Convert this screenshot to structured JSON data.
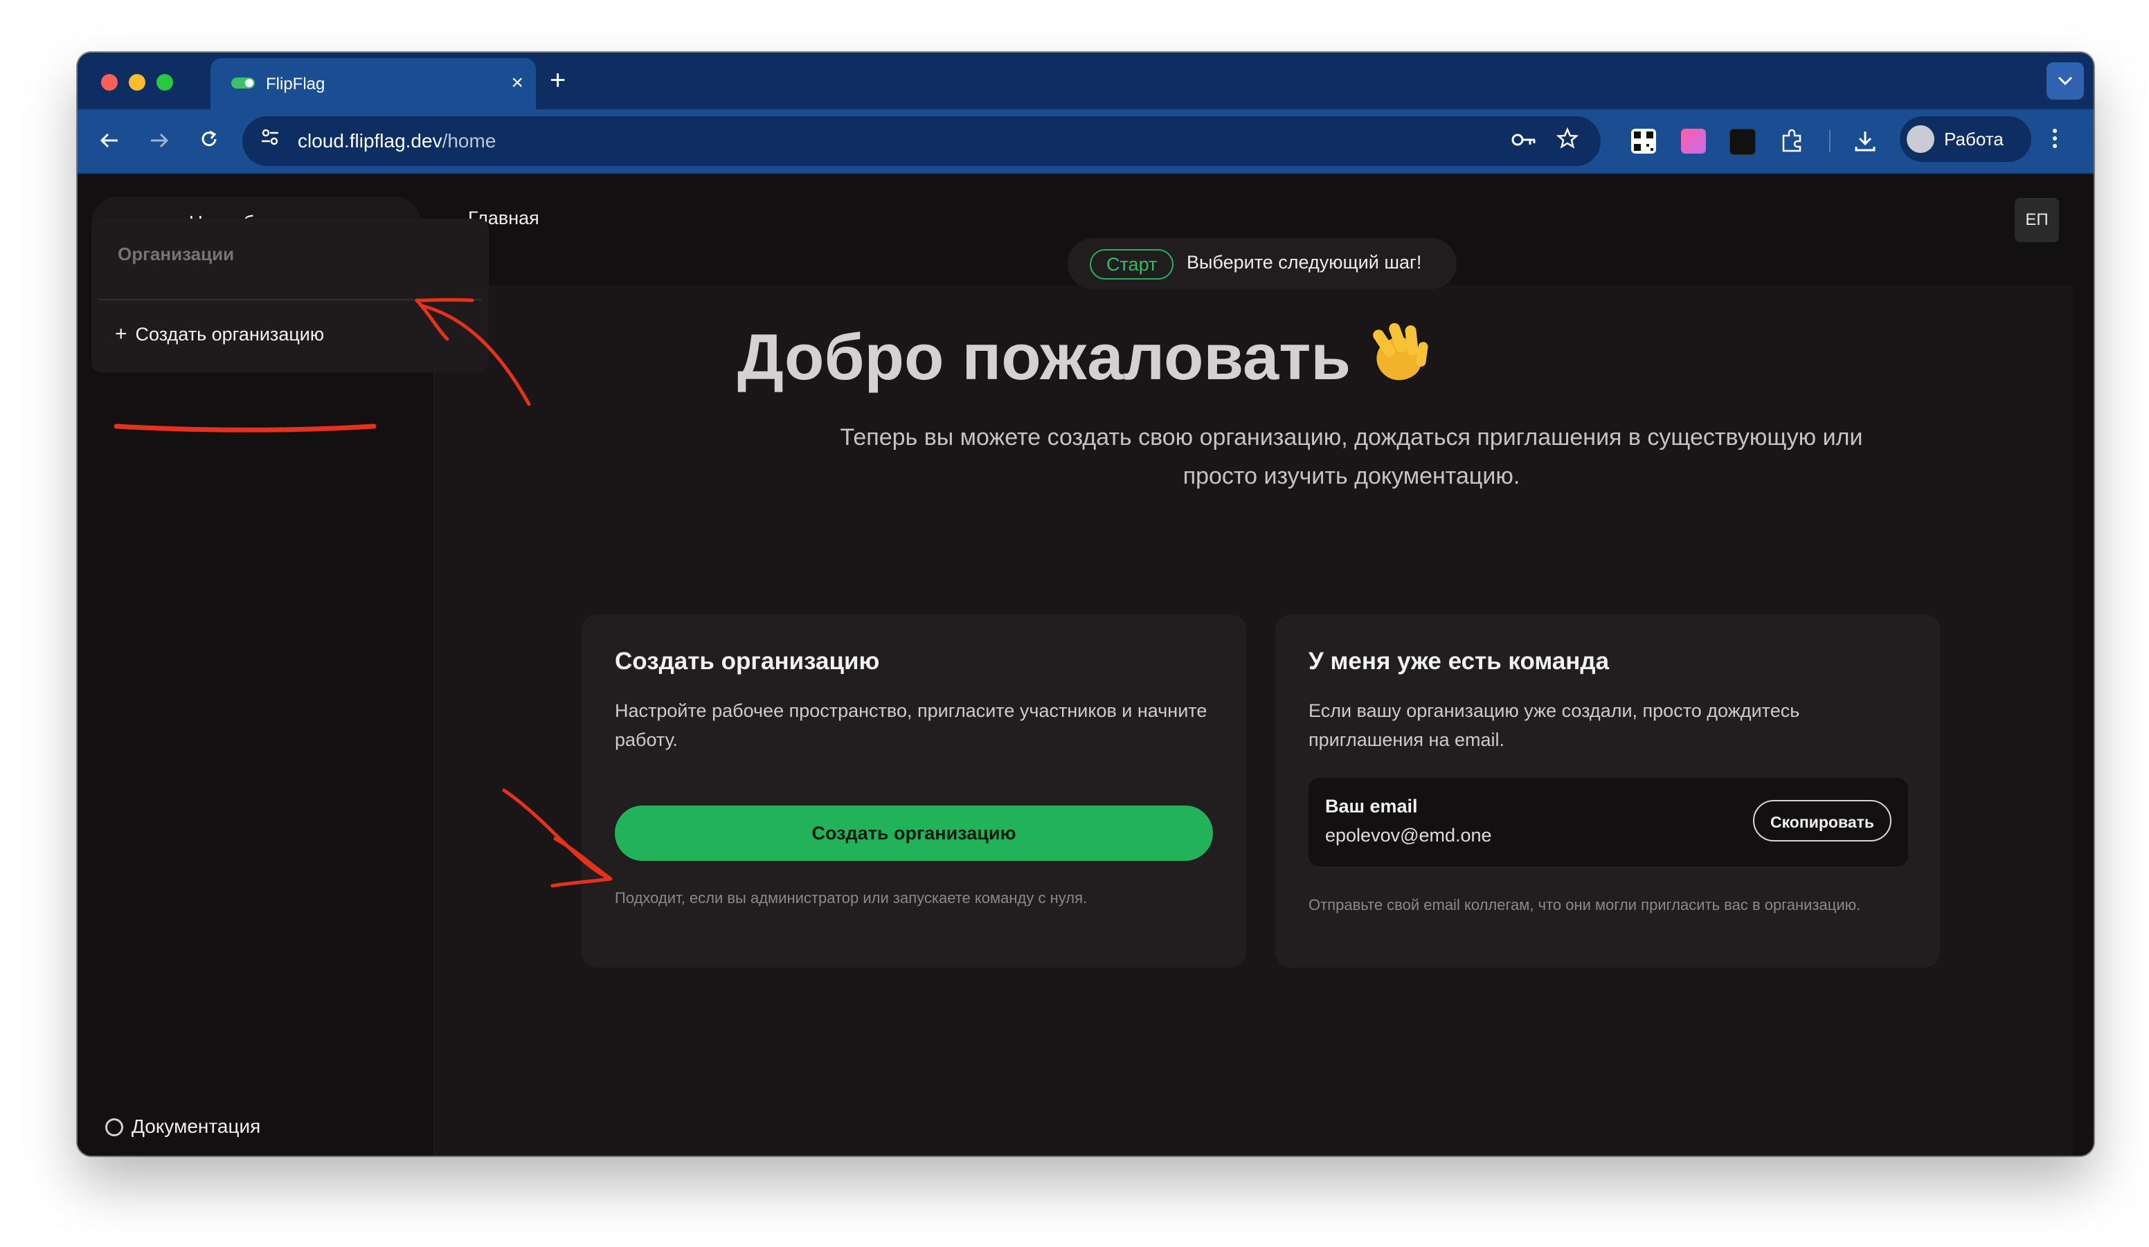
{
  "browser": {
    "tab_title": "FlipFlag",
    "close_glyph": "×",
    "new_tab_glyph": "+",
    "url_host": "cloud.flipflag.dev",
    "url_path": "/home",
    "profile_label": "Работа",
    "traffic_colors": [
      "#ff5f57",
      "#febc2e",
      "#28c840"
    ]
  },
  "sidebar": {
    "org_selector_label": "Не выбрано",
    "menu_header": "Организации",
    "menu_item": "Создать организацию",
    "docs_label": "Документация"
  },
  "header": {
    "breadcrumb": "Главная",
    "user_initials": "ЕП"
  },
  "hero": {
    "badge": "Старт",
    "badge_text": "Выберите следующий шаг!",
    "title": "Добро пожаловать",
    "subtitle": "Теперь вы можете создать свою организацию, дождаться приглашения в существующую или просто изучить документацию."
  },
  "create_card": {
    "title": "Создать организацию",
    "description": "Настройте рабочее пространство, пригласите участников и начните работу.",
    "button": "Создать организацию",
    "note": "Подходит, если вы администратор или запускаете команду с нуля."
  },
  "team_card": {
    "title": "У меня уже есть команда",
    "description": "Если вашу организацию уже создали, просто дождитесь приглашения на email.",
    "email_label": "Ваш email",
    "email_value": "epolevov@emd.one",
    "copy_button": "Скопировать",
    "note": "Отправьте свой email коллегам, что они могли пригласить вас в организацию."
  },
  "colors": {
    "accent_green": "#22b25a",
    "annotation_red": "#e8311a",
    "chrome_blue": "#1a4d92"
  }
}
